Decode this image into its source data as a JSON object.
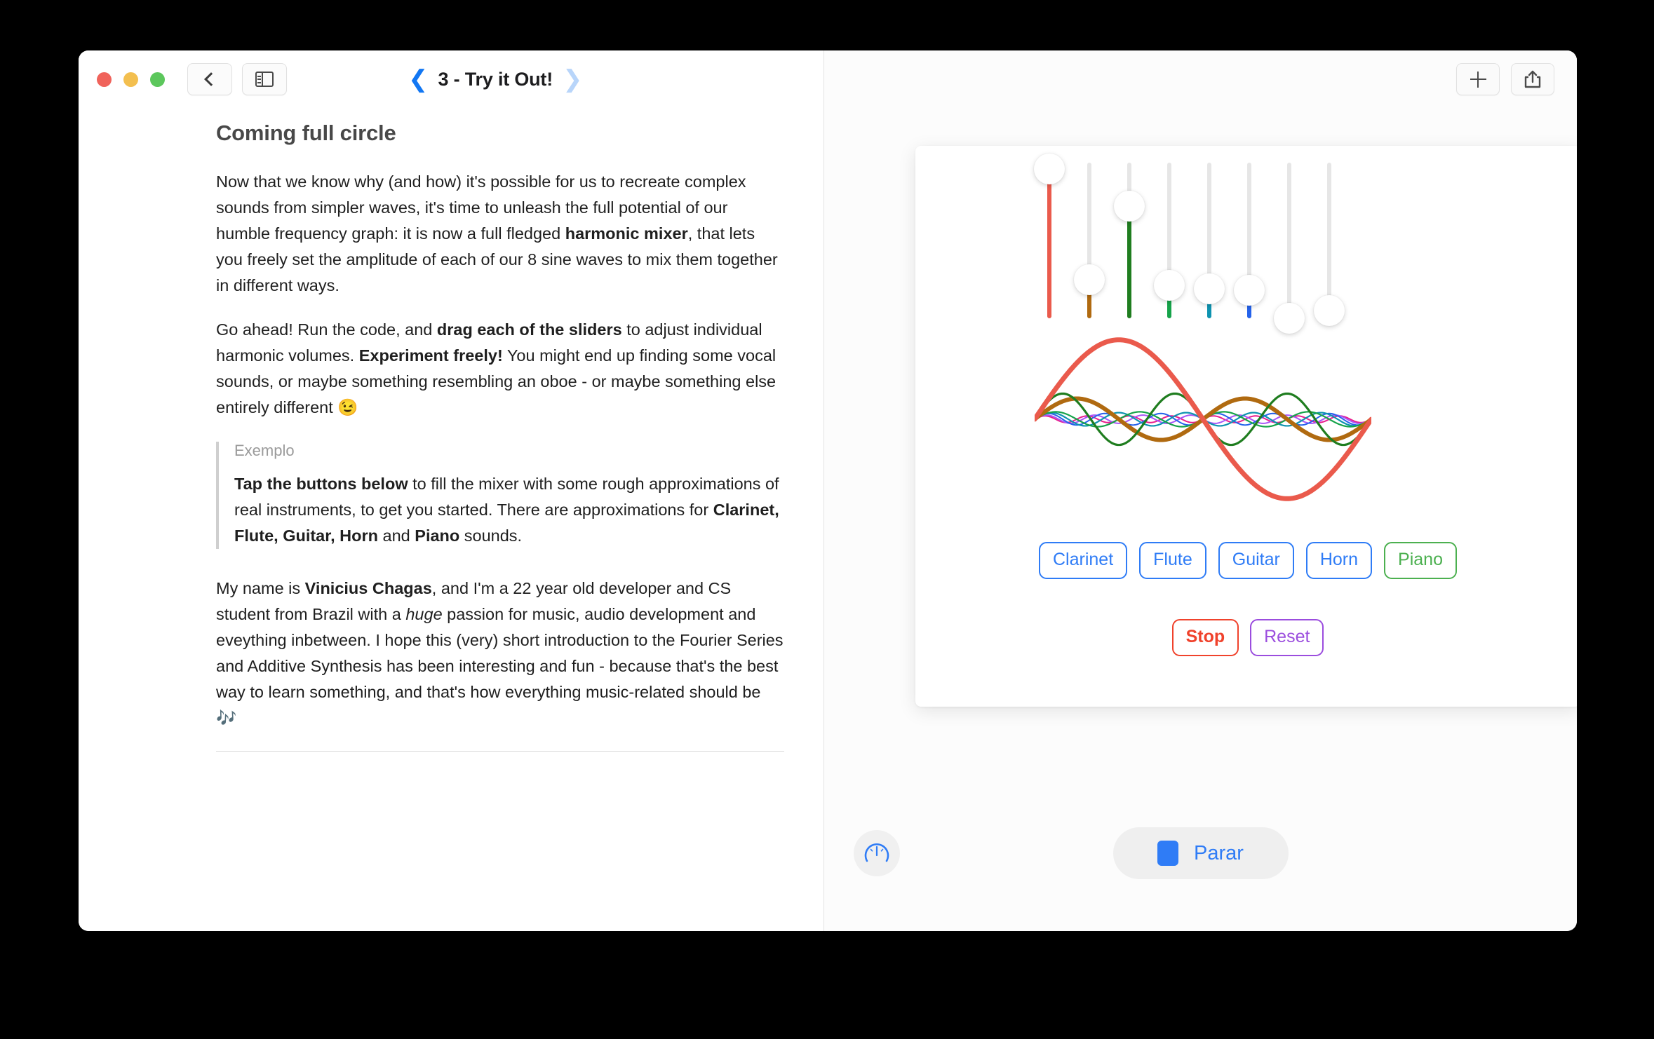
{
  "window": {
    "traffic_lights": [
      "close",
      "minimize",
      "zoom"
    ],
    "back_button_icon": "chevron-left-icon",
    "sidebar_toggle_icon": "sidebar-icon",
    "page_nav": {
      "prev_icon": "chevron-left-icon",
      "next_icon": "chevron-right-icon",
      "title": "3 - Try it Out!"
    },
    "toolbar_right": [
      {
        "name": "add-button",
        "icon": "plus-icon"
      },
      {
        "name": "share-button",
        "icon": "share-icon"
      }
    ]
  },
  "article": {
    "heading": "Coming full circle",
    "paragraph_1": {
      "part1": "Now that we know why (and how) it's possible for us to recreate complex sounds from simpler waves, it's time to unleash the full potential of our humble frequency graph: it is now a full fledged ",
      "bold1": "harmonic mixer",
      "part2": ", that lets you freely set the amplitude of each of our 8 sine waves to mix them together in different ways."
    },
    "paragraph_2": {
      "part1": "Go ahead! Run the code, and ",
      "bold1": "drag each of the sliders",
      "part2": " to adjust individual harmonic volumes. ",
      "bold2": "Experiment freely!",
      "part3": " You might end up finding some vocal sounds, or maybe something resembling an oboe - or maybe something else entirely different 😉"
    },
    "callout": {
      "label": "Exemplo",
      "bold1": "Tap the buttons below",
      "part1": " to fill the mixer with some rough approximations of real instruments, to get you started. There are approximations for ",
      "bold2": "Clarinet, Flute, Guitar, Horn",
      "part2": " and ",
      "bold3": "Piano",
      "part3": " sounds."
    },
    "paragraph_3": {
      "part1": "My name is ",
      "bold1": "Vinicius Chagas",
      "part2": ", and I'm a 22 year old developer and CS student from Brazil with a ",
      "italic1": "huge",
      "part3": " passion for music, audio development and eveything inbetween. I hope this (very) short introduction to the Fourier Series and Additive Synthesis has been interesting and fun - because that's the best way to learn something, and that's how everything music-related should be 🎶"
    }
  },
  "live_view": {
    "mixer": {
      "label": "harmonic-mixer",
      "slider_count": 8,
      "sliders": [
        {
          "harmonic": 1,
          "value": 0.96,
          "color": "#ea5a4c"
        },
        {
          "harmonic": 2,
          "value": 0.25,
          "color": "#b06a10"
        },
        {
          "harmonic": 3,
          "value": 0.72,
          "color": "#1f7d1f"
        },
        {
          "harmonic": 4,
          "value": 0.21,
          "color": "#16a34a"
        },
        {
          "harmonic": 5,
          "value": 0.19,
          "color": "#0e93b0"
        },
        {
          "harmonic": 6,
          "value": 0.18,
          "color": "#2563eb"
        },
        {
          "harmonic": 7,
          "value": 0.0,
          "color": "#a855f7"
        },
        {
          "harmonic": 8,
          "value": 0.05,
          "color": "#e91e8c"
        }
      ]
    },
    "waveform": {
      "harmonics": [
        {
          "harmonic": 1,
          "amplitude": 0.96,
          "color": "#ea5a4c",
          "width": 7
        },
        {
          "harmonic": 2,
          "amplitude": 0.25,
          "color": "#b06a10",
          "width": 6
        },
        {
          "harmonic": 3,
          "amplitude": 0.31,
          "color": "#1f7d1f",
          "width": 3.2
        },
        {
          "harmonic": 4,
          "amplitude": 0.09,
          "color": "#16a34a",
          "width": 2.2
        },
        {
          "harmonic": 5,
          "amplitude": 0.08,
          "color": "#0e93b0",
          "width": 2.2
        },
        {
          "harmonic": 6,
          "amplitude": 0.07,
          "color": "#2563eb",
          "width": 2.0
        },
        {
          "harmonic": 7,
          "amplitude": 0.05,
          "color": "#a855f7",
          "width": 2.0
        },
        {
          "harmonic": 8,
          "amplitude": 0.04,
          "color": "#e91e8c",
          "width": 2.0
        }
      ]
    },
    "instrument_buttons": [
      {
        "label": "Clarinet",
        "selected": false
      },
      {
        "label": "Flute",
        "selected": false
      },
      {
        "label": "Guitar",
        "selected": false
      },
      {
        "label": "Horn",
        "selected": false
      },
      {
        "label": "Piano",
        "selected": true
      }
    ],
    "transport_buttons": [
      {
        "label": "Stop",
        "style": "stop"
      },
      {
        "label": "Reset",
        "style": "reset"
      }
    ]
  },
  "bottom_bar": {
    "gauge_icon": "speedometer-icon",
    "run_button": {
      "icon": "stop-square-icon",
      "label": "Parar"
    }
  },
  "colors": {
    "accent_blue": "#2f7cf6",
    "green": "#4cb050",
    "red": "#f0422c",
    "purple": "#9b4dde"
  }
}
